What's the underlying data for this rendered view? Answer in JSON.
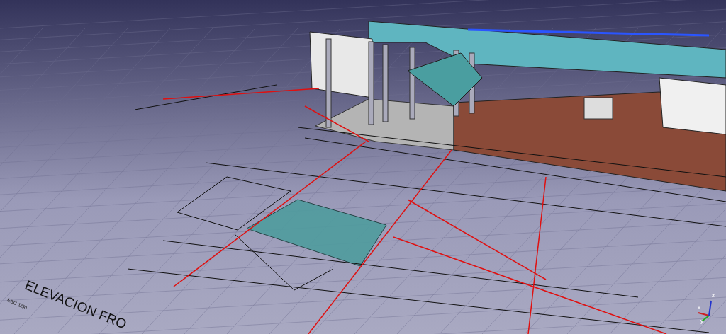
{
  "viewport": {
    "drawing_title": "ELEVACION FRO",
    "scale_note": "ESC 1/50"
  },
  "axis_indicator": {
    "labels": [
      {
        "text": "x",
        "color": "#cc2222"
      },
      {
        "text": "y",
        "color": "#22aa22"
      },
      {
        "text": "z",
        "color": "#2233cc"
      }
    ]
  }
}
